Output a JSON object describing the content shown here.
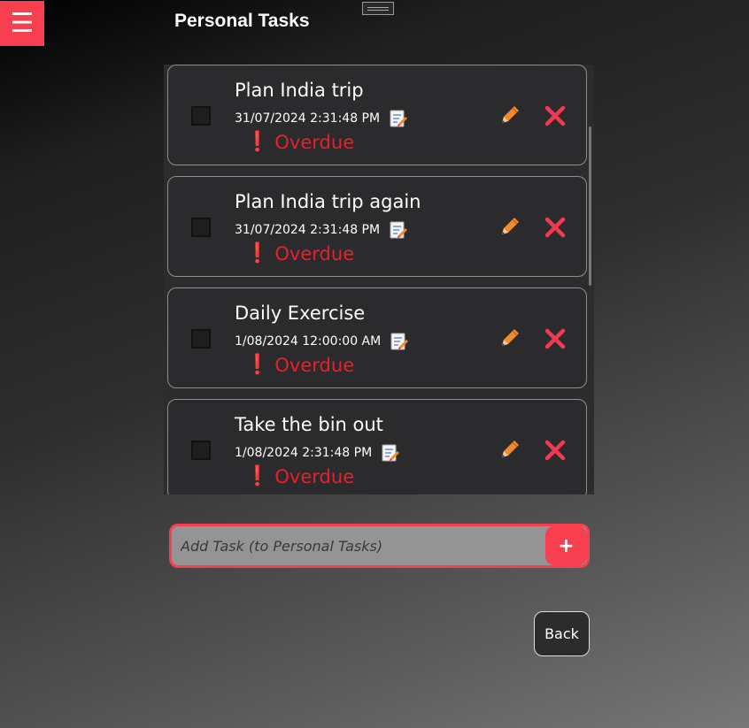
{
  "header": {
    "title": "Personal Tasks",
    "menu_icon": "hamburger-icon"
  },
  "tasks": [
    {
      "title": "Plan India trip",
      "date": "31/07/2024 2:31:48 PM",
      "status": "Overdue"
    },
    {
      "title": "Plan India trip again",
      "date": "31/07/2024 2:31:48 PM",
      "status": "Overdue"
    },
    {
      "title": "Daily Exercise",
      "date": "1/08/2024 12:00:00 AM",
      "status": "Overdue"
    },
    {
      "title": "Take the bin out",
      "date": "1/08/2024 2:31:48 PM",
      "status": "Overdue"
    }
  ],
  "add_task": {
    "placeholder": "Add Task (to Personal Tasks)",
    "button_label": "+"
  },
  "back_label": "Back",
  "colors": {
    "accent": "#f73f4f",
    "overdue": "#e8202a",
    "edit": "#f08a2e",
    "delete": "#f03a52"
  }
}
